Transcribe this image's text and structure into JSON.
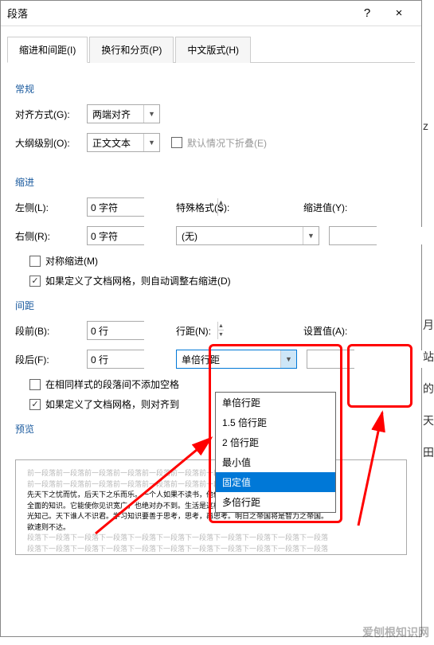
{
  "dialog": {
    "title": "段落",
    "help": "?",
    "close": "×"
  },
  "tabs": {
    "t1": "缩进和间距(I)",
    "t2": "换行和分页(P)",
    "t3": "中文版式(H)"
  },
  "sections": {
    "general": "常规",
    "indent": "缩进",
    "spacing": "间距",
    "preview": "预览"
  },
  "general": {
    "align_label": "对齐方式(G):",
    "align_value": "两端对齐",
    "outline_label": "大纲级别(O):",
    "outline_value": "正文文本",
    "collapse_label": "默认情况下折叠(E)"
  },
  "indent": {
    "left_label": "左侧(L):",
    "left_value": "0 字符",
    "right_label": "右侧(R):",
    "right_value": "0 字符",
    "special_label": "特殊格式(S):",
    "special_value": "(无)",
    "indent_value_label": "缩进值(Y):",
    "mirror_label": "对称缩进(M)",
    "grid_label": "如果定义了文档网格，则自动调整右缩进(D)"
  },
  "spacing": {
    "before_label": "段前(B):",
    "before_value": "0 行",
    "after_label": "段后(F):",
    "after_value": "0 行",
    "line_spacing_label": "行距(N):",
    "line_spacing_value": "单倍行距",
    "set_value_label": "设置值(A):",
    "no_space_label": "在相同样式的段落间不添加空格",
    "grid_align_label": "如果定义了文档网格，则对齐到"
  },
  "dropdown": {
    "opt1": "单倍行距",
    "opt2": "1.5 倍行距",
    "opt3": "2 倍行距",
    "opt4": "最小值",
    "opt5": "固定值",
    "opt6": "多倍行距"
  },
  "preview": {
    "gray_line": "前一段落前一段落前一段落前一段落前一段落前一段落前一段落前一段落前一段落前一段落",
    "black1": "先天下之忧而忧，后天下之乐而乐。一个人如果不读书，他便无法知晓前人的智慧，也将无法获得",
    "black2": "全面的知识。它能使你见识宽广，也绝对办不到。生活是这样完整，活他一千辈子吧！莫开始",
    "black3": "光知己。天下谁人不识君。学习知识要善于思考，思考，再思考。明日之帝国将是智力之帝国。",
    "black4": "欲速则不达。",
    "gray_line2": "段落下一段落下一段落下一段落下一段落下一段落下一段落下一段落下一段落下一段落下一段落"
  },
  "side": {
    "c1": "z",
    "c2": "月",
    "c3": "站",
    "c4": "的",
    "c5": "天",
    "c6": "田"
  },
  "watermark": "爱刨根知识网"
}
